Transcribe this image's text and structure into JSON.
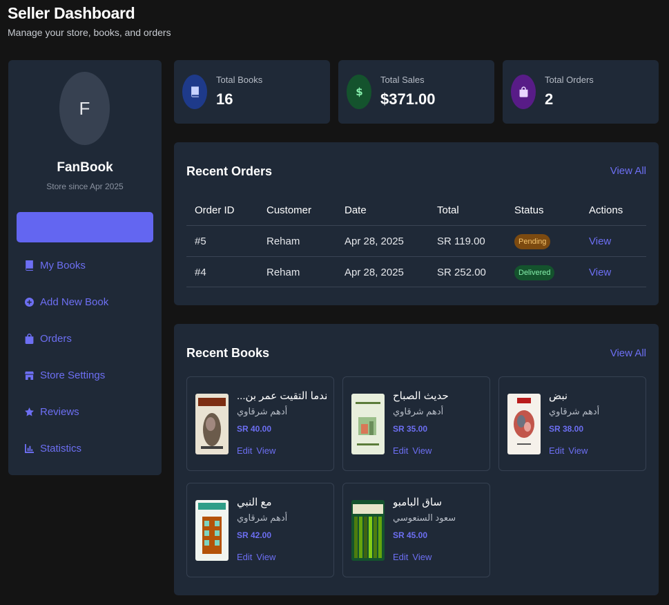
{
  "header": {
    "title": "Seller Dashboard",
    "subtitle": "Manage your store, books, and orders"
  },
  "sidebar": {
    "avatar_initial": "F",
    "store_name": "FanBook",
    "store_since": "Store since Apr 2025",
    "active_button_label": "",
    "items": [
      {
        "label": "My Books",
        "icon": "book-icon"
      },
      {
        "label": "Add New Book",
        "icon": "plus-circle-icon"
      },
      {
        "label": "Orders",
        "icon": "bag-icon"
      },
      {
        "label": "Store Settings",
        "icon": "store-icon"
      },
      {
        "label": "Reviews",
        "icon": "star-icon"
      },
      {
        "label": "Statistics",
        "icon": "chart-icon"
      }
    ]
  },
  "stats": [
    {
      "label": "Total Books",
      "value": "16",
      "icon": "book-icon",
      "color": "#1e3a8a"
    },
    {
      "label": "Total Sales",
      "value": "$371.00",
      "icon": "dollar-icon",
      "color": "#14532d"
    },
    {
      "label": "Total Orders",
      "value": "2",
      "icon": "bag-icon",
      "color": "#581c87"
    }
  ],
  "recent_orders": {
    "title": "Recent Orders",
    "view_all": "View All",
    "columns": [
      "Order ID",
      "Customer",
      "Date",
      "Total",
      "Status",
      "Actions"
    ],
    "rows": [
      {
        "id": "#5",
        "customer": "Reham",
        "date": "Apr 28, 2025",
        "total": "SR 119.00",
        "status": "Pending",
        "action": "View"
      },
      {
        "id": "#4",
        "customer": "Reham",
        "date": "Apr 28, 2025",
        "total": "SR 252.00",
        "status": "Delivered",
        "action": "View"
      }
    ]
  },
  "recent_books": {
    "title": "Recent Books",
    "view_all": "View All",
    "edit_label": "Edit",
    "view_label": "View",
    "books": [
      {
        "title": "...عندما التقيت عمر بن",
        "author": "أدهم شرقاوي",
        "price": "SR 40.00"
      },
      {
        "title": "حديث الصباح",
        "author": "أدهم شرقاوي",
        "price": "SR 35.00"
      },
      {
        "title": "نبض",
        "author": "أدهم شرقاوي",
        "price": "SR 38.00"
      },
      {
        "title": "مع النبي",
        "author": "أدهم شرقاوي",
        "price": "SR 42.00"
      },
      {
        "title": "ساق البامبو",
        "author": "سعود السنعوسي",
        "price": "SR 45.00"
      }
    ]
  },
  "colors": {
    "accent": "#6366f1",
    "background": "#141414",
    "card": "#1f2937"
  }
}
